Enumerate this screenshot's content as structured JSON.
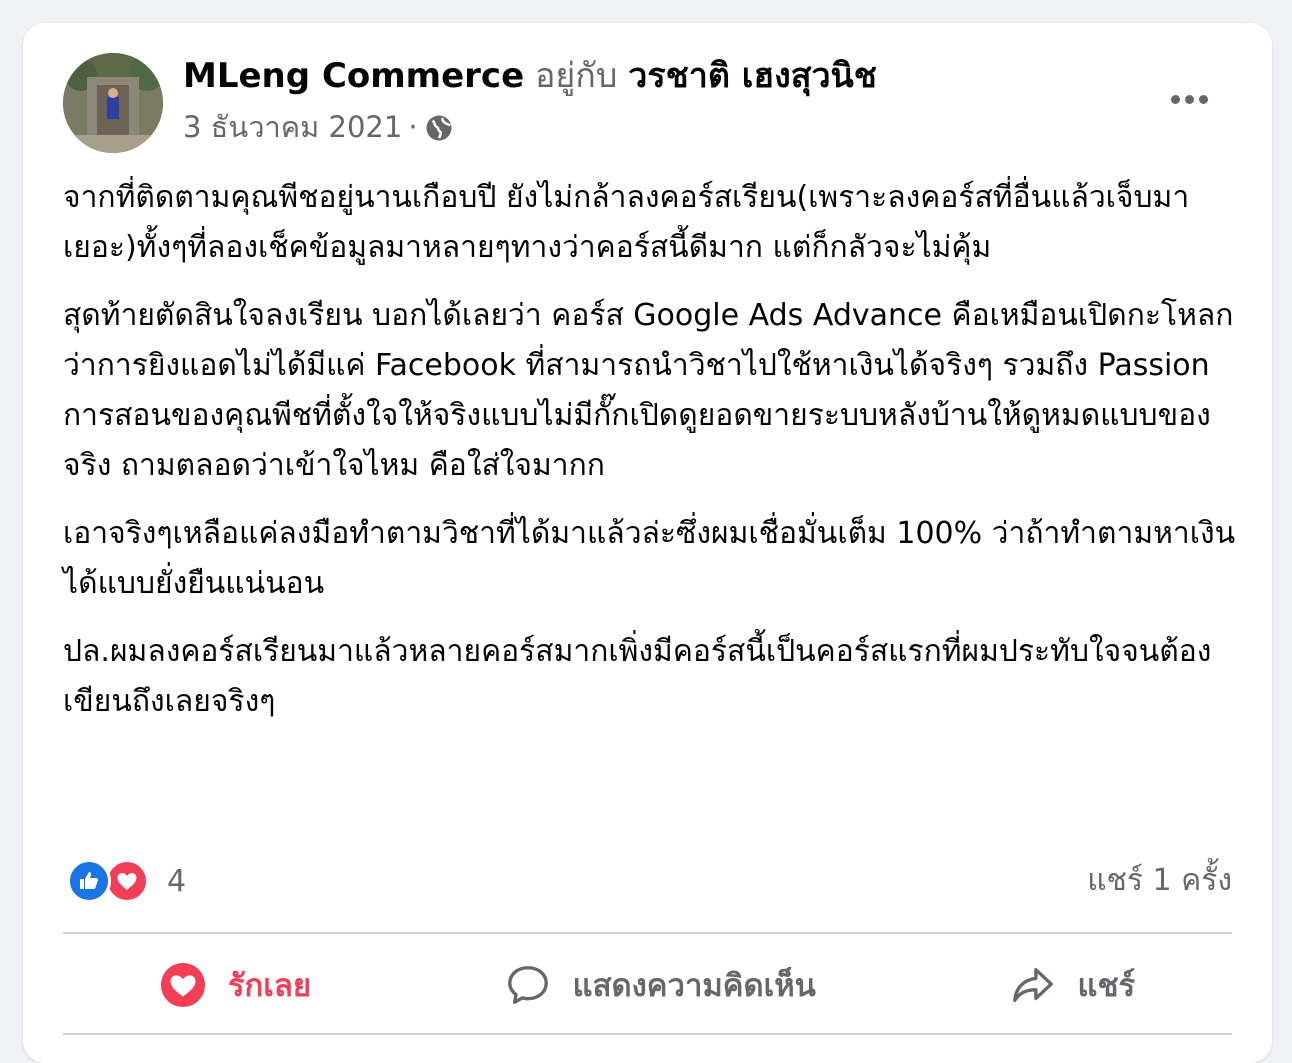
{
  "post": {
    "author": "MLeng Commerce",
    "with_label": "อยู่กับ",
    "tagged_person": "วรชาติ เฮงสุวนิช",
    "date": "3 ธันวาคม 2021",
    "separator": "·",
    "privacy_icon": "globe-icon",
    "more_icon": "more-options-icon",
    "paragraphs": [
      "จากที่ติดตามคุณพีชอยู่นานเกือบปี ยังไม่กล้าลงคอร์สเรียน(เพราะลงคอร์สที่อื่นแล้วเจ็บมาเยอะ)ทั้งๆที่ลองเช็คข้อมูลมาหลายๆทางว่าคอร์สนี้ดีมาก แต่ก็กลัวจะไม่คุ้ม",
      "สุดท้ายตัดสินใจลงเรียน บอกได้เลยว่า คอร์ส Google Ads Advance คือเหมือนเปิดกะโหลกว่าการยิงแอดไม่ได้มีแค่ Facebook ที่สามารถนำวิชาไปใช้หาเงินได้จริงๆ รวมถึง Passion การสอนของคุณพีชที่ตั้งใจให้จริงแบบไม่มีกั๊กเปิดดูยอดขายระบบหลังบ้านให้ดูหมดแบบของจริง ถามตลอดว่าเข้าใจไหม คือใส่ใจมากก",
      "เอาจริงๆเหลือแค่ลงมือทำตามวิชาที่ได้มาแล้วล่ะซึ่งผมเชื่อมั่นเต็ม 100% ว่าถ้าทำตามหาเงินได้แบบยั่งยืนแน่นอน",
      "ปล.ผมลงคอร์สเรียนมาแล้วหลายคอร์สมากเพิ่งมีคอร์สนี้เป็นคอร์สแรกที่ผมประทับใจจนต้องเขียนถึงเลยจริงๆ"
    ]
  },
  "reactions": {
    "count": "4",
    "icons": [
      "like-icon",
      "love-icon"
    ]
  },
  "shares": {
    "label": "แชร์ 1 ครั้ง"
  },
  "actions": {
    "love_label": "รักเลย",
    "comment_label": "แสดงความคิดเห็น",
    "share_label": "แชร์"
  },
  "colors": {
    "background": "#f0f2f5",
    "card": "#ffffff",
    "text_primary": "#050505",
    "text_secondary": "#65676b",
    "like_blue": "#1b74e4",
    "love_red": "#f33e58",
    "divider": "#ced0d4"
  }
}
